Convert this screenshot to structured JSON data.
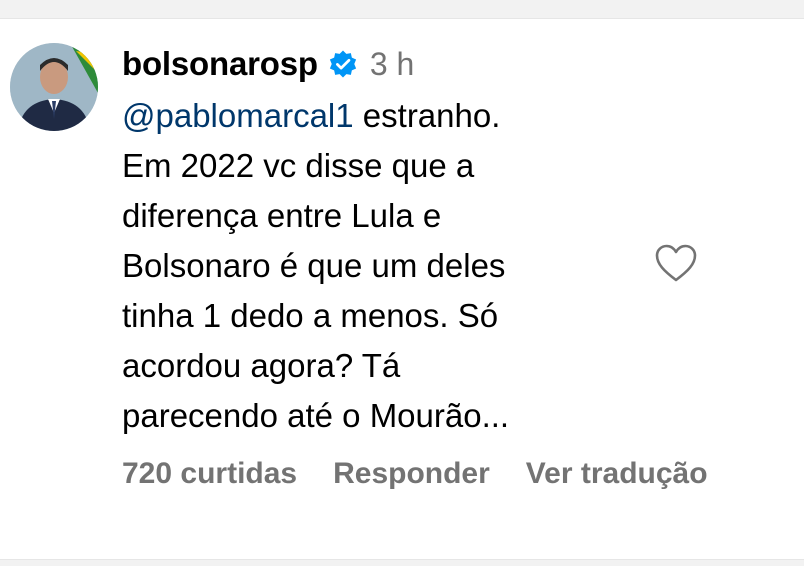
{
  "comment": {
    "username": "bolsonarosp",
    "verified_icon": "verified-badge-icon",
    "time": "3 h",
    "mention": "@pablomarcal1",
    "text_after_mention": " estranho.\nEm 2022 vc disse que a\ndiferença entre Lula e\nBolsonaro é que um deles\ntinha 1 dedo a menos. Só\nacordou agora? Tá\nparecendo até o Mourão...",
    "likes_label": "720 curtidas",
    "reply_label": "Responder",
    "translate_label": "Ver tradução",
    "like_icon": "heart-outline-icon"
  },
  "colors": {
    "mention": "#00376b",
    "muted": "#737373",
    "verified": "#0095f6"
  }
}
